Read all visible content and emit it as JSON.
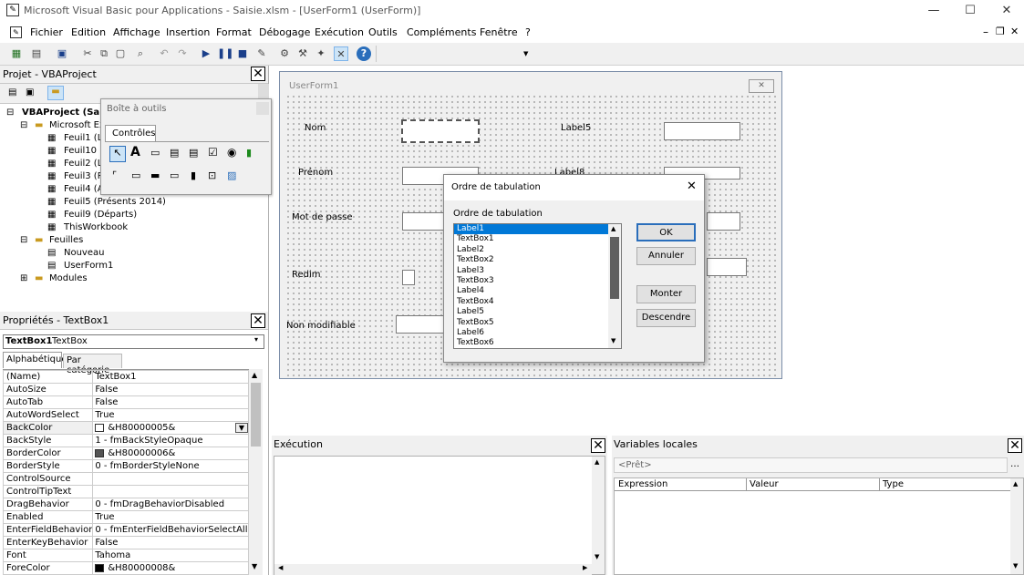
{
  "window": {
    "title": "Microsoft Visual Basic pour Applications - Saisie.xlsm - [UserForm1 (UserForm)]"
  },
  "menu": [
    "Fichier",
    "Edition",
    "Affichage",
    "Insertion",
    "Format",
    "Débogage",
    "Exécution",
    "Outils",
    "Compléments",
    "Fenêtre",
    "?"
  ],
  "project": {
    "title": "Projet - VBAProject",
    "nodes": [
      {
        "label": "VBAProject (Sa",
        "bold": true
      },
      {
        "label": "Microsoft Exc"
      },
      {
        "label": "Feuil1 (Lis"
      },
      {
        "label": "Feuil10 (S"
      },
      {
        "label": "Feuil2 (Lis"
      },
      {
        "label": "Feuil3 (Pr"
      },
      {
        "label": "Feuil4 (Ar"
      },
      {
        "label": "Feuil5 (Présents 2014)"
      },
      {
        "label": "Feuil9 (Départs)"
      },
      {
        "label": "ThisWorkbook"
      },
      {
        "label": "Feuilles"
      },
      {
        "label": "Nouveau"
      },
      {
        "label": "UserForm1"
      },
      {
        "label": "Modules"
      }
    ]
  },
  "toolbox": {
    "title": "Boîte à outils",
    "tab": "Contrôles"
  },
  "properties": {
    "title": "Propriétés - TextBox1",
    "object": "TextBox1",
    "object_type": "TextBox",
    "tabs": [
      "Alphabétique",
      "Par catégorie"
    ],
    "rows": [
      {
        "name": "(Name)",
        "value": "TextBox1"
      },
      {
        "name": "AutoSize",
        "value": "False"
      },
      {
        "name": "AutoTab",
        "value": "False"
      },
      {
        "name": "AutoWordSelect",
        "value": "True"
      },
      {
        "name": "BackColor",
        "value": "&H80000005&",
        "swatch": "#ffffff"
      },
      {
        "name": "BackStyle",
        "value": "1 - fmBackStyleOpaque"
      },
      {
        "name": "BorderColor",
        "value": "&H80000006&",
        "swatch": "#555555"
      },
      {
        "name": "BorderStyle",
        "value": "0 - fmBorderStyleNone"
      },
      {
        "name": "ControlSource",
        "value": ""
      },
      {
        "name": "ControlTipText",
        "value": ""
      },
      {
        "name": "DragBehavior",
        "value": "0 - fmDragBehaviorDisabled"
      },
      {
        "name": "Enabled",
        "value": "True"
      },
      {
        "name": "EnterFieldBehavior",
        "value": "0 - fmEnterFieldBehaviorSelectAll"
      },
      {
        "name": "EnterKeyBehavior",
        "value": "False"
      },
      {
        "name": "Font",
        "value": "Tahoma"
      },
      {
        "name": "ForeColor",
        "value": "&H80000008&",
        "swatch": "#000000"
      }
    ]
  },
  "userform": {
    "title": "UserForm1",
    "labels": [
      "Nom",
      "Prénom",
      "Mot de passe",
      "Redim",
      "Non modifiable",
      "Label5",
      "Label8"
    ]
  },
  "dialog": {
    "title": "Ordre de tabulation",
    "group_label": "Ordre de tabulation",
    "items": [
      "Label1",
      "TextBox1",
      "Label2",
      "TextBox2",
      "Label3",
      "TextBox3",
      "Label4",
      "TextBox4",
      "Label5",
      "TextBox5",
      "Label6",
      "TextBox6"
    ],
    "buttons": {
      "ok": "OK",
      "cancel": "Annuler",
      "up": "Monter",
      "down": "Descendre"
    }
  },
  "execution": {
    "title": "Exécution"
  },
  "locals": {
    "title": "Variables locales",
    "status": "<Prêt>",
    "columns": [
      "Expression",
      "Valeur",
      "Type"
    ]
  }
}
